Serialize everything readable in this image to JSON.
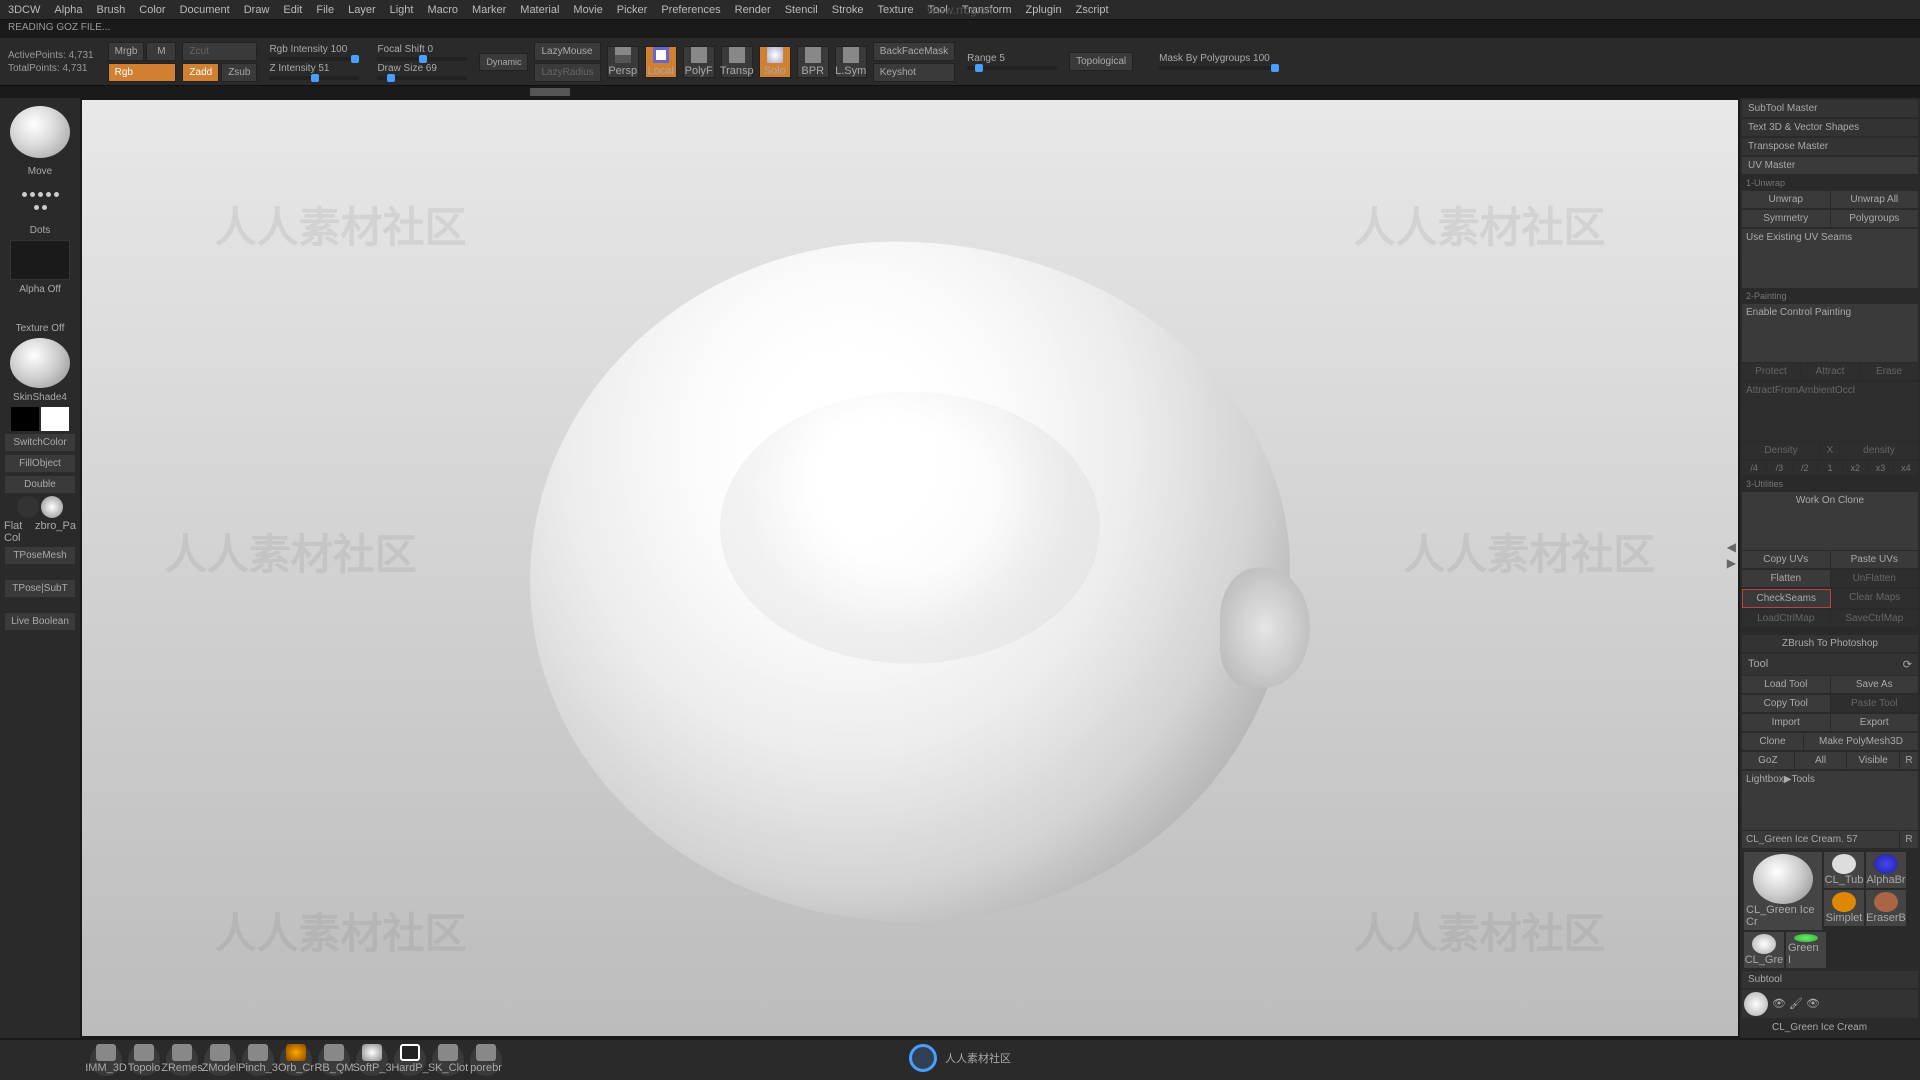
{
  "watermark_url": "www.rrcg.cn",
  "watermark_text": "人人素材社区",
  "menu": [
    "3DCW",
    "Alpha",
    "Brush",
    "Color",
    "Document",
    "Draw",
    "Edit",
    "File",
    "Layer",
    "Light",
    "Macro",
    "Marker",
    "Material",
    "Movie",
    "Picker",
    "Preferences",
    "Render",
    "Stencil",
    "Stroke",
    "Texture",
    "Tool",
    "Transform",
    "Zplugin",
    "Zscript"
  ],
  "status": "READING GOZ FILE...",
  "stats": {
    "active": "ActivePoints: 4,731",
    "total": "TotalPoints: 4,731"
  },
  "modes": {
    "mrgb": "Mrgb",
    "rgb": "Rgb",
    "m": "M",
    "zcut": "Zcut",
    "zadd": "Zadd",
    "zsub": "Zsub"
  },
  "sliders": {
    "rgbint": "Rgb Intensity 100",
    "zint": "Z Intensity 51",
    "focal": "Focal Shift 0",
    "drawsize": "Draw Size 69"
  },
  "dynamic": "Dynamic",
  "lazy": {
    "mouse": "LazyMouse",
    "radius": "LazyRadius"
  },
  "tbicons": {
    "persp": "Persp",
    "local": "Local",
    "polyf": "PolyF",
    "transp": "Transp",
    "solo": "Solo",
    "bpr": "BPR",
    "lsym": "L.Sym"
  },
  "tbext": {
    "bfm": "BackFaceMask",
    "keyshot": "Keyshot",
    "range": "Range 5",
    "topo": "Topological",
    "maskpg": "Mask By Polygroups 100"
  },
  "left": {
    "move": "Move",
    "dots": "Dots",
    "alphaoff": "Alpha Off",
    "texoff": "Texture Off",
    "shade": "SkinShade4",
    "switch": "SwitchColor",
    "fill": "FillObject",
    "double": "Double",
    "flat": "Flat Col",
    "zbro": "zbro_Pa",
    "tpose": "TPoseMesh",
    "tposesub": "TPose|SubT",
    "livebool": "Live Boolean"
  },
  "right": {
    "plugins": [
      "SubTool Master",
      "Text 3D & Vector Shapes",
      "Transpose Master",
      "UV Master"
    ],
    "sec1": "1-Unwrap",
    "unwrap": "Unwrap",
    "unwrapall": "Unwrap All",
    "sym": "Symmetry",
    "polyg": "Polygroups",
    "useseams": "Use Existing UV Seams",
    "sec2": "2-Painting",
    "enablecp": "Enable Control Painting",
    "protect": "Protect",
    "attract": "Attract",
    "erase": "Erase",
    "attractamb": "AttractFromAmbientOccl",
    "density": "Density",
    "densx": "X",
    "densval": "density",
    "d4": "/4",
    "d3": "/3",
    "d2": "/2",
    "d1": "1",
    "x2": "x2",
    "x3": "x3",
    "x4": "x4",
    "sec3": "3-Utilities",
    "workclone": "Work On Clone",
    "copyuv": "Copy UVs",
    "pasteuv": "Paste UVs",
    "flatten": "Flatten",
    "unflatten": "UnFlatten",
    "checkseams": "CheckSeams",
    "clearmaps": "Clear Maps",
    "loadctrl": "LoadCtrlMap",
    "savectrl": "SaveCtrlMap",
    "zb2ps": "ZBrush To Photoshop",
    "tool": "Tool",
    "loadtool": "Load Tool",
    "saveas": "Save As",
    "copytool": "Copy Tool",
    "pastetool": "Paste Tool",
    "import": "Import",
    "export": "Export",
    "clone": "Clone",
    "makepoly": "Make PolyMesh3D",
    "goz": "GoZ",
    "all": "All",
    "visible": "Visible",
    "r": "R",
    "lightbox": "Lightbox▶Tools",
    "cltool": "CL_Green Ice Cream. 57",
    "th_main": "CL_Green Ice Cr",
    "th_tub": "CL_Tub",
    "th_alpha": "AlphaBr",
    "th_simple": "Simplet",
    "th_eraser": "EraserB",
    "th_gre": "CL_Gre",
    "th_green": "Green I",
    "subtool": "Subtool",
    "st_name": "CL_Green Ice Cream"
  },
  "bottom": [
    "IMM_3D",
    "Topolo",
    "ZRemes",
    "ZModel",
    "Pinch_3",
    "Orb_Cr",
    "RB_QM",
    "SoftP_3",
    "HardP_",
    "SK_Clot",
    "porebr"
  ],
  "logo": "人人素材社区"
}
